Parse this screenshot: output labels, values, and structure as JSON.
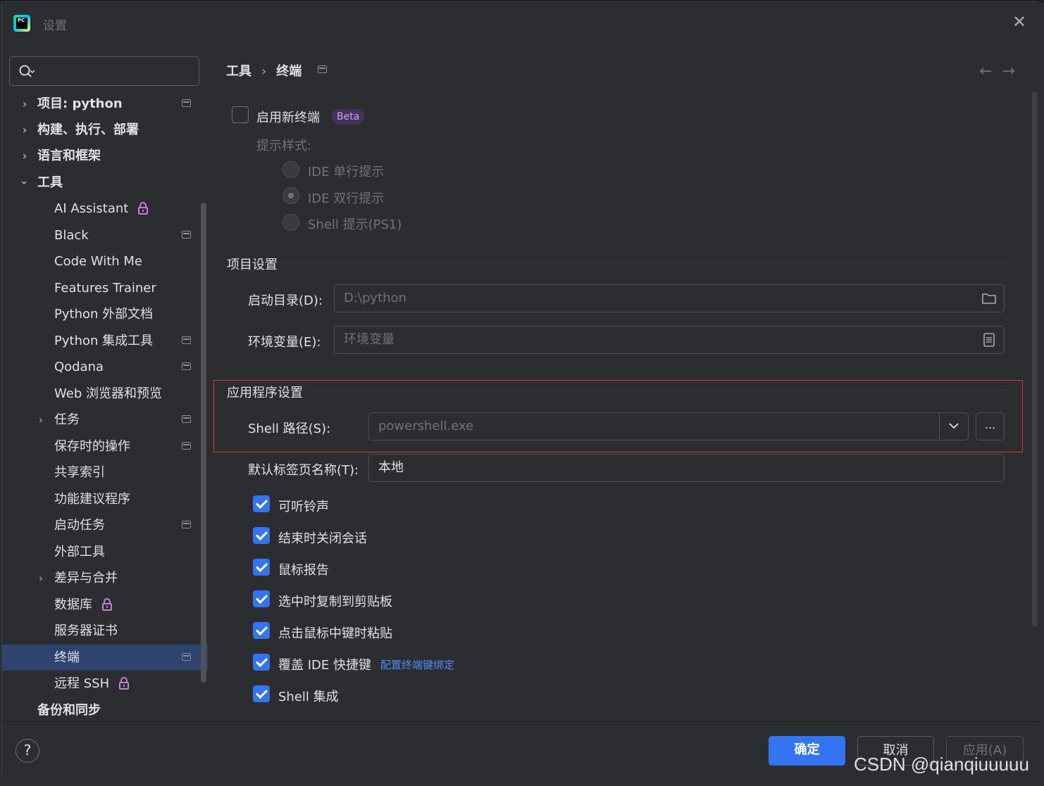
{
  "window": {
    "title": "设置"
  },
  "sidebar": {
    "search": {
      "placeholder": ""
    },
    "items": [
      {
        "label": "项目: python",
        "level": 0,
        "arrow": "collapsed",
        "project_icon": true,
        "bold": true
      },
      {
        "label": "构建、执行、部署",
        "level": 0,
        "arrow": "collapsed",
        "project_icon": false,
        "bold": true
      },
      {
        "label": "语言和框架",
        "level": 0,
        "arrow": "collapsed",
        "project_icon": false,
        "bold": true
      },
      {
        "label": "工具",
        "level": 0,
        "arrow": "expanded",
        "project_icon": false,
        "bold": true
      },
      {
        "label": "AI Assistant",
        "level": 1,
        "locked": true
      },
      {
        "label": "Black",
        "level": 1,
        "project_icon": true
      },
      {
        "label": "Code With Me",
        "level": 1
      },
      {
        "label": "Features Trainer",
        "level": 1
      },
      {
        "label": "Python 外部文档",
        "level": 1
      },
      {
        "label": "Python 集成工具",
        "level": 1,
        "project_icon": true
      },
      {
        "label": "Qodana",
        "level": 1,
        "project_icon": true
      },
      {
        "label": "Web 浏览器和预览",
        "level": 1
      },
      {
        "label": "任务",
        "level": 1,
        "arrow": "collapsed",
        "project_icon": true
      },
      {
        "label": "保存时的操作",
        "level": 1,
        "project_icon": true
      },
      {
        "label": "共享索引",
        "level": 1
      },
      {
        "label": "功能建议程序",
        "level": 1
      },
      {
        "label": "启动任务",
        "level": 1,
        "project_icon": true
      },
      {
        "label": "外部工具",
        "level": 1
      },
      {
        "label": "差异与合并",
        "level": 1,
        "arrow": "collapsed"
      },
      {
        "label": "数据库",
        "level": 1,
        "locked": true
      },
      {
        "label": "服务器证书",
        "level": 1
      },
      {
        "label": "终端",
        "level": 1,
        "project_icon": true,
        "selected": true
      },
      {
        "label": "远程 SSH",
        "level": 1,
        "locked": true
      },
      {
        "label": "备份和同步",
        "level": 0,
        "bold": true
      }
    ]
  },
  "main": {
    "breadcrumb": {
      "parent": "工具",
      "separator": "›",
      "current": "终端"
    },
    "nav": {
      "back": "←",
      "forward": "→"
    },
    "new_terminal": {
      "label": "启用新终端",
      "badge": "Beta",
      "checked": false
    },
    "prompt_style": {
      "label": "提示样式:",
      "options": [
        {
          "label": "IDE 单行提示",
          "selected": false
        },
        {
          "label": "IDE 双行提示",
          "selected": true
        },
        {
          "label": "Shell 提示(PS1)",
          "selected": false
        }
      ]
    },
    "project_settings": {
      "header": "项目设置",
      "start_dir": {
        "label": "启动目录(D):",
        "value": "D:\\python"
      },
      "env_vars": {
        "label": "环境变量(E):",
        "placeholder": "环境变量"
      }
    },
    "app_settings": {
      "header": "应用程序设置",
      "shell_path": {
        "label": "Shell 路径(S):",
        "value": "powershell.exe",
        "browse": "..."
      },
      "default_tab": {
        "label": "默认标签页名称(T):",
        "value": "本地"
      }
    },
    "checkboxes": [
      {
        "label": "可听铃声",
        "checked": true
      },
      {
        "label": "结束时关闭会话",
        "checked": true
      },
      {
        "label": "鼠标报告",
        "checked": true
      },
      {
        "label": "选中时复制到剪贴板",
        "checked": true
      },
      {
        "label": "点击鼠标中键时粘贴",
        "checked": true
      },
      {
        "label": "覆盖 IDE 快捷键",
        "checked": true,
        "link": "配置终端键绑定"
      },
      {
        "label": "Shell 集成",
        "checked": true
      }
    ]
  },
  "footer": {
    "help": "?",
    "ok": "确定",
    "cancel": "取消",
    "apply": "应用(A)"
  },
  "watermark": "CSDN @qianqiuuuuu",
  "colors": {
    "accent": "#3574f0",
    "selection": "#2e436e",
    "highlight_box": "#e0373e",
    "beta_text": "#c5a3ff",
    "lock": "#c77dd6"
  }
}
